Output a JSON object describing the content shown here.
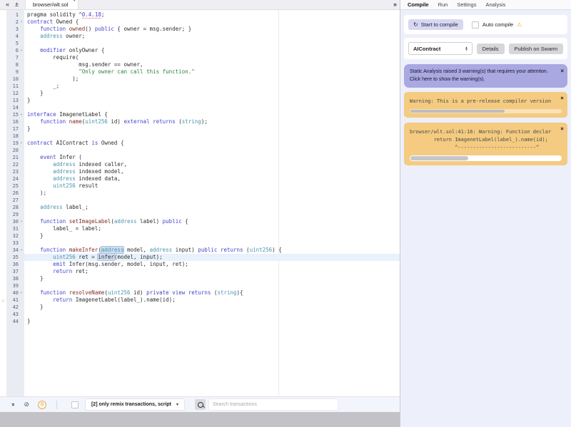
{
  "tabbar": {
    "collapse_left_icon": "«",
    "plus_icon": "±",
    "active_tab": "browser/wlt.sol",
    "unsaved_indicator": "*",
    "toggle_right_icon": "»"
  },
  "editor": {
    "active_line": 35,
    "fold_lines": [
      2,
      6,
      15,
      19,
      30,
      34,
      40
    ],
    "warning_lines": [
      41
    ],
    "occurrences": {
      "34": "address",
      "35": "infer"
    },
    "icons": {
      "warning": "⚠",
      "fold": "▾"
    },
    "lines": [
      "pragma solidity ^0.4.18;",
      "contract Owned {",
      "    function owned() public { owner = msg.sender; }",
      "    address owner;",
      "",
      "    modifier onlyOwner {",
      "        require(",
      "                msg.sender == owner,",
      "                \"Only owner can call this function.\"",
      "              );",
      "        _;",
      "    }",
      "}",
      "",
      "interface ImagenetLabel {",
      "    function name(uint256 id) external returns (string);",
      "}",
      "",
      "contract AIContract is Owned {",
      "",
      "    event Infer (",
      "        address indexed caller,",
      "        address indexed model,",
      "        address indexed data,",
      "        uint256 result",
      "    );",
      "",
      "    address label_;",
      "",
      "    function setImageLabel(address label) public {",
      "        label_ = label;",
      "    }",
      "",
      "    function makeInfer(address model, address input) public returns (uint256) {",
      "        uint256 ret = infer(model, input);",
      "        emit Infer(msg.sender, model, input, ret);",
      "        return ret;",
      "    }",
      "",
      "    function resolveName(uint256 id) private view returns (string){",
      "        return ImagenetLabel(label_).name(id);",
      "    }",
      "",
      "}"
    ]
  },
  "terminal": {
    "collapse_icon": "«",
    "clear_icon": "⊘",
    "badge_count": "0",
    "filter_label": "[2] only remix transactions, script",
    "filter_caret": "▾",
    "search_placeholder": "Search transactions"
  },
  "right_panel": {
    "tabs": [
      "Compile",
      "Run",
      "Settings",
      "Analysis"
    ],
    "active_tab": "Compile",
    "compile": {
      "start_icon": "↻",
      "start_button": "Start to compile",
      "auto_compile_label": "Auto compile",
      "auto_compile_warning_icon": "⚠",
      "contract_select_value": "AIContract",
      "details_button": "Details",
      "publish_button": "Publish on Swarm"
    },
    "notifications": {
      "close_icon": "×",
      "static_analysis_line1": "Static Analysis raised 3 warning(s) that requires your attention.",
      "static_analysis_line2": "Click here to show the warning(s).",
      "compiler_warning": "Warning: This is a pre-release compiler version",
      "function_warning": [
        "browser/wlt.sol:41:16: Warning: Function declar",
        "        return ImagenetLabel(label_).name(id);",
        "               ^--------------------------^"
      ]
    }
  },
  "colors": {
    "accent_purple_note": "#a9a8e1",
    "warning_orange_box": "#f4cb80",
    "compile_button": "#d7d7f1",
    "gray_button": "#d6d6db",
    "active_line": "#e8f1fc",
    "gutter_bg": "#e9ecf2",
    "keyword": "#4444cc",
    "type": "#4a93ad",
    "string": "#2d7f3f",
    "warning_icon": "#e8a33d"
  }
}
